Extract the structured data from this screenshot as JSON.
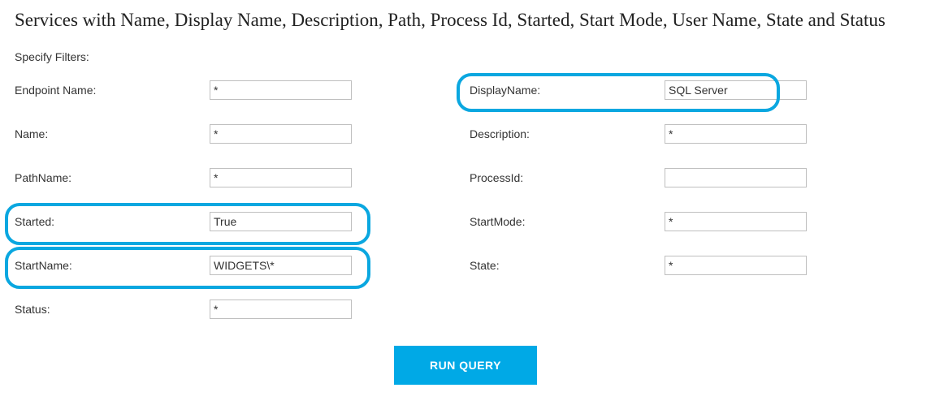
{
  "heading": "Services with Name, Display Name, Description, Path, Process Id, Started, Start Mode, User Name, State and Status",
  "specify_label": "Specify Filters:",
  "left": [
    {
      "label": "Endpoint Name:",
      "value": "*"
    },
    {
      "label": "Name:",
      "value": "*"
    },
    {
      "label": "PathName:",
      "value": "*"
    },
    {
      "label": "Started:",
      "value": "True"
    },
    {
      "label": "StartName:",
      "value": "WIDGETS\\*"
    },
    {
      "label": "Status:",
      "value": "*"
    }
  ],
  "right": [
    {
      "label": "DisplayName:",
      "value": "SQL Server"
    },
    {
      "label": "Description:",
      "value": "*"
    },
    {
      "label": "ProcessId:",
      "value": ""
    },
    {
      "label": "StartMode:",
      "value": "*"
    },
    {
      "label": "State:",
      "value": "*"
    }
  ],
  "button": {
    "label": "RUN QUERY"
  }
}
